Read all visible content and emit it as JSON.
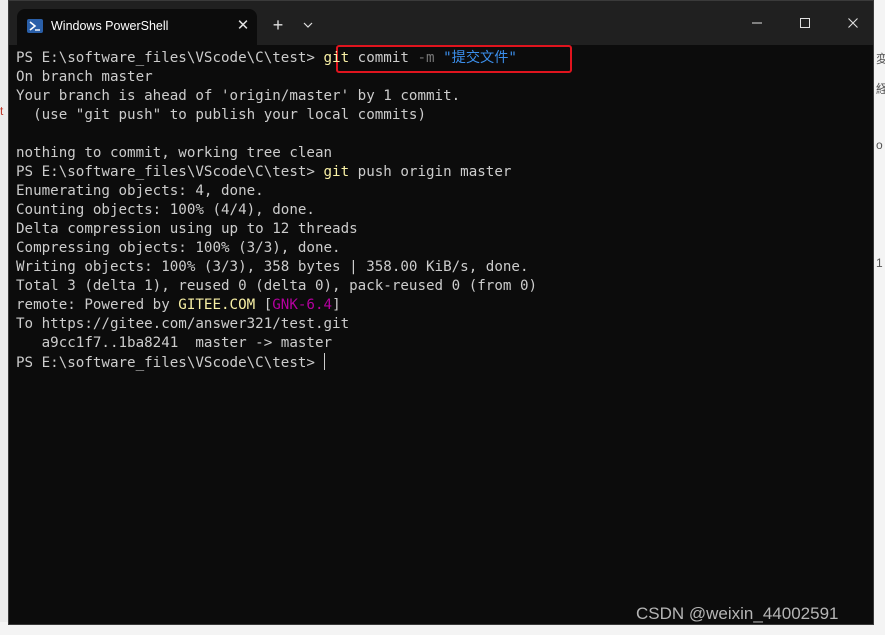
{
  "window": {
    "tab_title": "Windows PowerShell",
    "tab_close_glyph": "✕",
    "new_tab_glyph": "+"
  },
  "terminal": {
    "prompt": "PS E:\\software_files\\VScode\\C\\test> ",
    "command1": {
      "git": "git",
      "commit": " commit ",
      "flag": "-m",
      "message": " \"提交文件\""
    },
    "output1": [
      "On branch master",
      "Your branch is ahead of 'origin/master' by 1 commit.",
      "  (use \"git push\" to publish your local commits)",
      "",
      "nothing to commit, working tree clean"
    ],
    "command2": {
      "git": "git",
      "rest": " push origin master"
    },
    "output2": [
      "Enumerating objects: 4, done.",
      "Counting objects: 100% (4/4), done.",
      "Delta compression using up to 12 threads",
      "Compressing objects: 100% (3/3), done.",
      "Writing objects: 100% (3/3), 358 bytes | 358.00 KiB/s, done.",
      "Total 3 (delta 1), reused 0 (delta 0), pack-reused 0 (from 0)"
    ],
    "remote_line": {
      "prefix": "remote: Powered by ",
      "gitee": "GITEE.COM",
      "open": " [",
      "gnk": "GNK-6.4",
      "close": "]"
    },
    "output3": [
      "To https://gitee.com/answer321/test.git",
      "   a9cc1f7..1ba8241  master -> master"
    ]
  },
  "watermark": "CSDN @weixin_44002591",
  "background": {
    "right_fragments": [
      "変",
      "経",
      "o",
      "1"
    ],
    "left_fragment": "t"
  },
  "colors": {
    "terminal_bg": "#0c0c0c",
    "titlebar_bg": "#202020",
    "text": "#cccccc",
    "yellow": "#f9f1a5",
    "blue": "#3b8eea",
    "grey": "#767676",
    "magenta": "#b4009e",
    "highlight_border": "#e0141e"
  },
  "icons": {
    "tab": "powershell-icon",
    "dropdown": "chevron-down-icon",
    "minimize": "minimize-icon",
    "maximize": "maximize-icon",
    "close": "close-icon"
  }
}
